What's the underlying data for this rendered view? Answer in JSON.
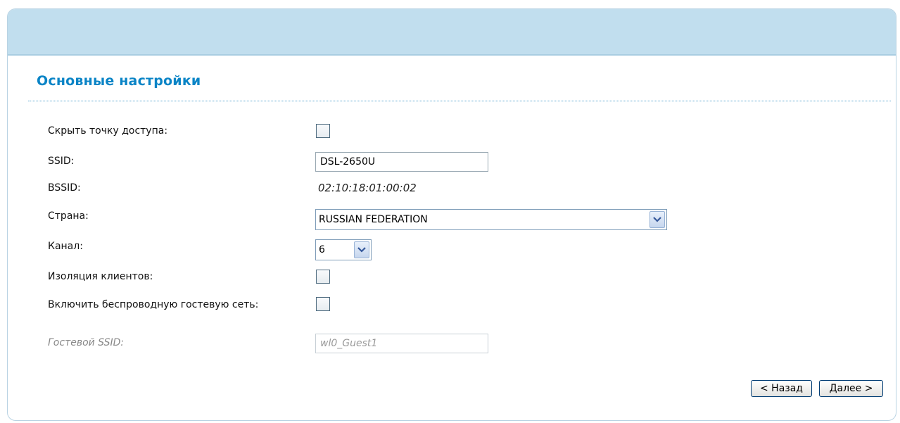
{
  "section": {
    "title": "Основные настройки"
  },
  "form": {
    "hide_ap_label": "Скрыть точку доступа:",
    "ssid_label": "SSID:",
    "ssid_value": "DSL-2650U",
    "bssid_label": "BSSID:",
    "bssid_value": "02:10:18:01:00:02",
    "country_label": "Страна:",
    "country_value": "RUSSIAN FEDERATION",
    "channel_label": "Канал:",
    "channel_value": "6",
    "isolation_label": "Изоляция клиентов:",
    "guest_enable_label": "Включить беспроводную гостевую сеть:",
    "guest_ssid_label": "Гостевой SSID:",
    "guest_ssid_value": "wl0_Guest1"
  },
  "buttons": {
    "back": "< Назад",
    "next": "Далее >"
  },
  "icons": {
    "dropdown": "chevron-down-icon"
  },
  "colors": {
    "accent": "#0a84c6",
    "header_bar": "#c1deee"
  }
}
